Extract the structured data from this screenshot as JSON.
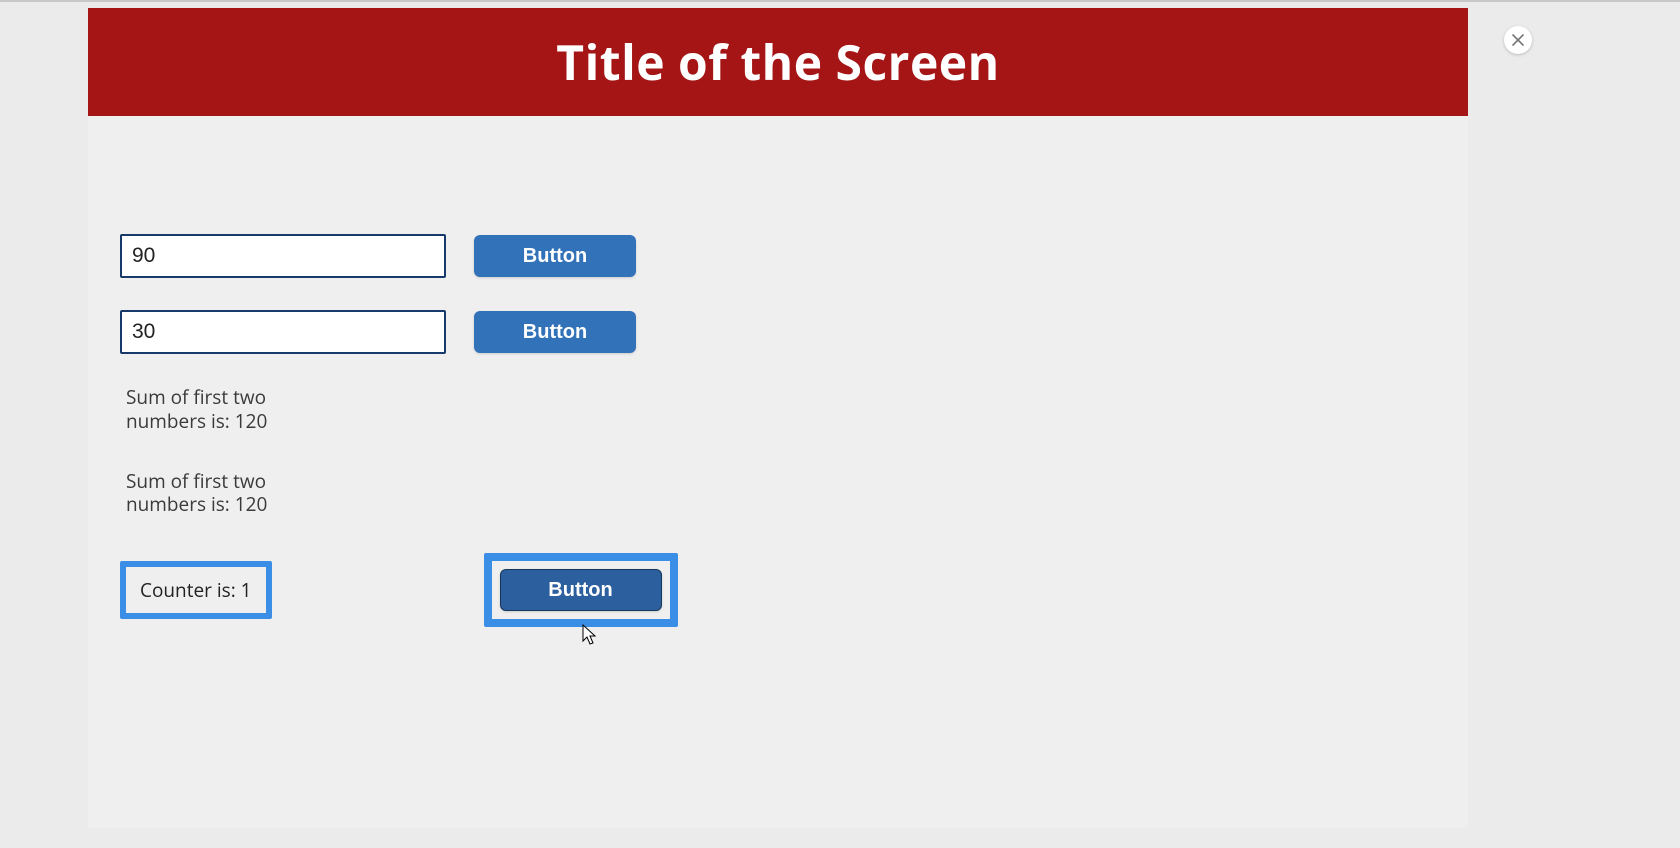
{
  "header": {
    "title": "Title of the Screen"
  },
  "inputs": {
    "first": {
      "value": "90"
    },
    "second": {
      "value": "30"
    }
  },
  "buttons": {
    "first": "Button",
    "second": "Button",
    "counter": "Button"
  },
  "sum": {
    "line1": "Sum of first two numbers is: 120",
    "line2": "Sum of first two numbers is: 120"
  },
  "counter": {
    "label": "Counter is: 1"
  },
  "close": {
    "aria": "Close"
  }
}
